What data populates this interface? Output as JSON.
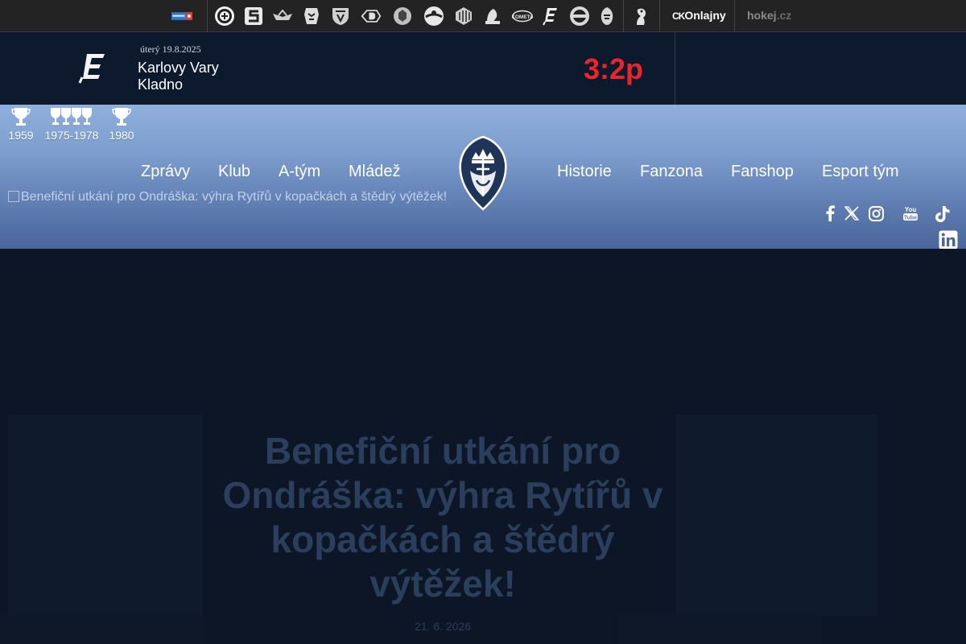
{
  "topbar": {
    "sponsor_logo": "tipsport-extraliga-logo",
    "team_logos": [
      "ceske-budejovice-logo",
      "sparta-logo",
      "hradec-kralove-logo",
      "liberec-logo",
      "trinec-logo",
      "pardubice-logo",
      "kladno-logo",
      "olomouc-logo",
      "litvinov-logo",
      "mlada-boleslav-logo",
      "kometa-brno-logo",
      "karlovy-vary-logo",
      "vitkovice-logo",
      "plzen-logo",
      "czech-lion-logo"
    ],
    "partner_links": [
      {
        "label": "Onlajny",
        "prefix": "CK"
      },
      {
        "label": "hokej",
        "suffix": ".cz"
      }
    ]
  },
  "scorebar": {
    "date": "úterý 19.8.2025",
    "home_team": "Karlovy Vary",
    "away_team": "Kladno",
    "score": "3:2p",
    "team_logo": "karlovy-vary-logo"
  },
  "hero": {
    "trophies": [
      {
        "year": "1959",
        "count": 1
      },
      {
        "year": "1975-1978",
        "count": 4
      },
      {
        "year": "1980",
        "count": 1
      }
    ],
    "nav_left": [
      "Zprávy",
      "Klub",
      "A-tým",
      "Mládež"
    ],
    "nav_right": [
      "Historie",
      "Fanzona",
      "Fanshop",
      "Esport tým"
    ],
    "broken_image_alt": "Benefiční utkání pro Ondráška: výhra Rytířů v kopačkách a štědrý výtěžek!",
    "club_logo": "rytiri-kladno-knight-logo",
    "social_icons": [
      "facebook-icon",
      "x-icon",
      "instagram-icon",
      "youtube-icon",
      "tiktok-icon",
      "linkedin-icon"
    ]
  },
  "article": {
    "title": "Benefiční utkání pro Ondráška: výhra Rytířů v kopačkách a štědrý výtěžek!",
    "date": "21. 6. 2026"
  },
  "colors": {
    "score_red": "#e8262b",
    "hero_top": "#8fb0dc",
    "hero_bottom": "#4a669a",
    "page_bg": "#0c1627",
    "topbar_bg": "#232323"
  }
}
